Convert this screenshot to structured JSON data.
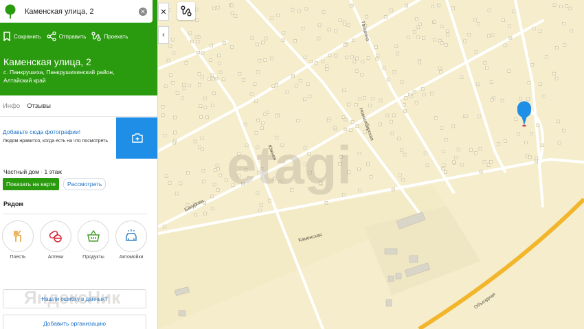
{
  "search": {
    "value": "Каменская улица, 2"
  },
  "actions": {
    "save": "Сохранить",
    "share": "Отправить",
    "route": "Проехать"
  },
  "place": {
    "title": "Каменская улица, 2",
    "address": "с. Панкрушиха, Панкрушихинский район, Алтайский край"
  },
  "tabs": [
    "Инфо",
    "Отзывы"
  ],
  "photo": {
    "link": "Добавьте сюда фотографии!",
    "sub": "Людям нравится, когда есть на что посмотреть"
  },
  "house": "Частный дом · 1 этаж",
  "buttons": {
    "show_on_map": "Показать на карте",
    "view": "Рассмотреть"
  },
  "nearby": {
    "title": "Рядом",
    "items": [
      {
        "label": "Поесть",
        "icon": "fork-knife-icon",
        "color": "#e8a23a"
      },
      {
        "label": "Аптеки",
        "icon": "pills-icon",
        "color": "#d9283a"
      },
      {
        "label": "Продукты",
        "icon": "basket-icon",
        "color": "#4a9d2f"
      },
      {
        "label": "Автомойки",
        "icon": "car-wash-icon",
        "color": "#3b82c4"
      }
    ]
  },
  "report_error": "Нашли ошибку в данных?",
  "add_org": "Добавить организацию",
  "watermarks": {
    "center": "etagi",
    "bottom_left": "ЯндексНик"
  },
  "map": {
    "streets": [
      "Гагарина",
      "Новосибирская",
      "Южная",
      "Бакурова",
      "Каменская",
      "Объездная"
    ],
    "colors": {
      "land": "#f5edcc",
      "road": "#ffffff",
      "highway": "#f2b52c",
      "marker": "#1e8ee6",
      "panel_green": "#2a9a0e"
    }
  }
}
